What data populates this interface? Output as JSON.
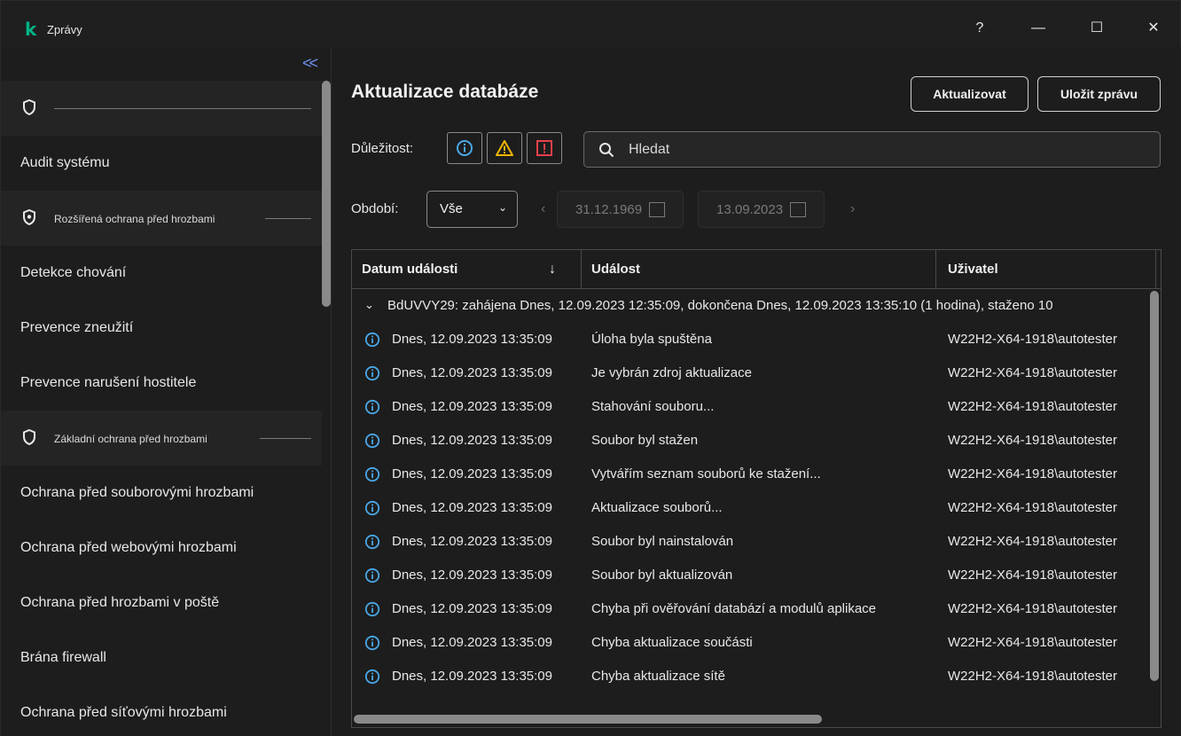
{
  "window": {
    "title": "Zprávy",
    "logo_glyph": "k",
    "logo_color": "#00b386",
    "controls": {
      "help": "?",
      "minimize": "—",
      "maximize": "☐",
      "close": "✕"
    }
  },
  "sidebar": {
    "collapse_glyph": "<<",
    "groups": [
      {
        "label": "",
        "icon": "shield-icon"
      },
      {
        "label": "Rozšířená ochrana před hrozbami",
        "icon": "shield-advanced-icon"
      },
      {
        "label": "Základní ochrana před hrozbami",
        "icon": "shield-icon"
      }
    ],
    "items": [
      "Audit systému",
      "Detekce chování",
      "Prevence zneužití",
      "Prevence narušení hostitele",
      "Ochrana před souborovými hrozbami",
      "Ochrana před webovými hrozbami",
      "Ochrana před hrozbami v poště",
      "Brána firewall",
      "Ochrana před síťovými hrozbami"
    ]
  },
  "main": {
    "title": "Aktualizace databáze",
    "buttons": {
      "update": "Aktualizovat",
      "save": "Uložit zprávu"
    },
    "severity_label": "Důležitost:",
    "severity_colors": {
      "info": "#4aa8e8",
      "warning": "#f0b400",
      "critical": "#e8404a"
    },
    "search": {
      "placeholder": "Hledat"
    },
    "period": {
      "label": "Období:",
      "selected": "Vše",
      "date_from": "31.12.1969",
      "date_to": "13.09.2023"
    },
    "table": {
      "columns": [
        "Datum události",
        "Událost",
        "Uživatel"
      ],
      "group": "BdUVVY29: zahájena Dnes, 12.09.2023 12:35:09, dokončena Dnes, 12.09.2023 13:35:10 (1 hodina), staženo 10",
      "rows": [
        {
          "date": "Dnes, 12.09.2023 13:35:09",
          "event": "Úloha byla spuštěna",
          "user": "W22H2-X64-1918\\autotester"
        },
        {
          "date": "Dnes, 12.09.2023 13:35:09",
          "event": "Je vybrán zdroj aktualizace",
          "user": "W22H2-X64-1918\\autotester"
        },
        {
          "date": "Dnes, 12.09.2023 13:35:09",
          "event": "Stahování souboru...",
          "user": "W22H2-X64-1918\\autotester"
        },
        {
          "date": "Dnes, 12.09.2023 13:35:09",
          "event": "Soubor byl stažen",
          "user": "W22H2-X64-1918\\autotester"
        },
        {
          "date": "Dnes, 12.09.2023 13:35:09",
          "event": "Vytvářím seznam souborů ke stažení...",
          "user": "W22H2-X64-1918\\autotester"
        },
        {
          "date": "Dnes, 12.09.2023 13:35:09",
          "event": "Aktualizace souborů...",
          "user": "W22H2-X64-1918\\autotester"
        },
        {
          "date": "Dnes, 12.09.2023 13:35:09",
          "event": "Soubor byl nainstalován",
          "user": "W22H2-X64-1918\\autotester"
        },
        {
          "date": "Dnes, 12.09.2023 13:35:09",
          "event": "Soubor byl aktualizován",
          "user": "W22H2-X64-1918\\autotester"
        },
        {
          "date": "Dnes, 12.09.2023 13:35:09",
          "event": "Chyba při ověřování databází a modulů aplikace",
          "user": "W22H2-X64-1918\\autotester"
        },
        {
          "date": "Dnes, 12.09.2023 13:35:09",
          "event": "Chyba aktualizace součásti",
          "user": "W22H2-X64-1918\\autotester"
        },
        {
          "date": "Dnes, 12.09.2023 13:35:09",
          "event": "Chyba aktualizace sítě",
          "user": "W22H2-X64-1918\\autotester"
        }
      ]
    }
  }
}
